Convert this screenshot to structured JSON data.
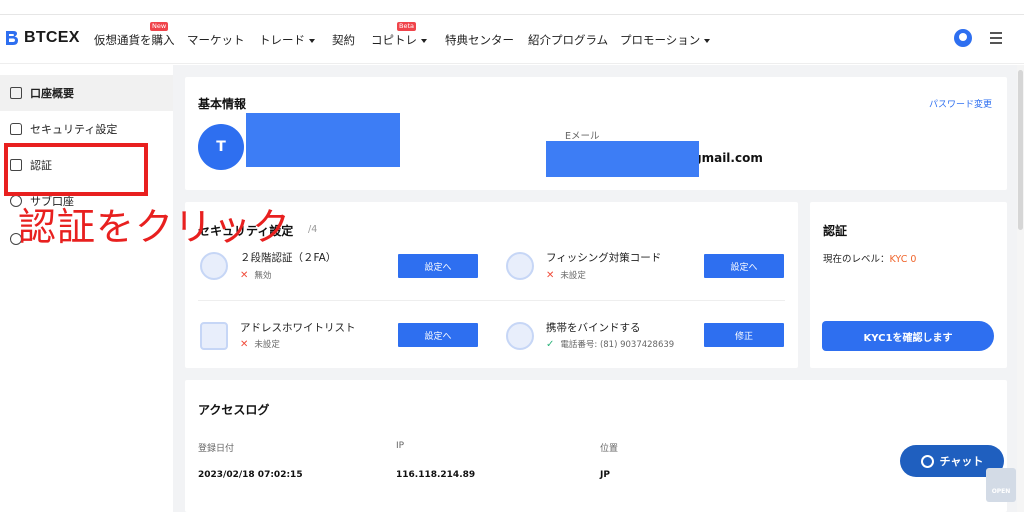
{
  "brand": {
    "name": "BTCEX"
  },
  "nav": {
    "items": [
      {
        "label": "仮想通貨を購入",
        "badge": "New",
        "has_caret": false
      },
      {
        "label": "マーケット",
        "badge": "",
        "has_caret": false
      },
      {
        "label": "トレード",
        "badge": "",
        "has_caret": true
      },
      {
        "label": "契約",
        "badge": "",
        "has_caret": false
      },
      {
        "label": "コピトレ",
        "badge": "Beta",
        "has_caret": true
      },
      {
        "label": "特典センター",
        "badge": "",
        "has_caret": false
      },
      {
        "label": "紹介プログラム",
        "badge": "",
        "has_caret": false
      },
      {
        "label": "プロモーション",
        "badge": "",
        "has_caret": true
      }
    ]
  },
  "sidebar": {
    "items": [
      {
        "label": "口座概要",
        "active": true
      },
      {
        "label": "セキュリティ設定",
        "active": false
      },
      {
        "label": "認証",
        "active": false
      },
      {
        "label": "サブ口座",
        "active": false
      }
    ]
  },
  "annotation": {
    "text": "認証をクリック"
  },
  "basic_info": {
    "title": "基本情報",
    "password_link": "パスワード変更",
    "avatar_initial": "T",
    "email_label": "Eメール",
    "email_suffix": "gmail.com"
  },
  "security": {
    "title": "セキュリティ設定",
    "count": "/4",
    "items": [
      {
        "name": "２段階認証（２FA）",
        "status": "無効",
        "ok": false,
        "button": "設定へ"
      },
      {
        "name": "フィッシング対策コード",
        "status": "未設定",
        "ok": false,
        "button": "設定へ"
      },
      {
        "name": "アドレスホワイトリスト",
        "status": "未設定",
        "ok": false,
        "button": "設定へ"
      },
      {
        "name": "携帯をバインドする",
        "status": "電話番号: (81) 9037428639",
        "ok": true,
        "button": "修正"
      }
    ]
  },
  "kyc": {
    "title": "認証",
    "level_label": "現在のレベル：",
    "level_value": "KYC 0",
    "button": "KYC1を確認します",
    "accent": "#f0652c"
  },
  "access_log": {
    "title": "アクセスログ",
    "columns": [
      "登録日付",
      "IP",
      "位置"
    ],
    "rows": [
      [
        "2023/02/18 07:02:15",
        "116.118.214.89",
        "JP"
      ]
    ]
  },
  "chat": {
    "label": "チャット"
  },
  "open_badge": {
    "label": "OPEN"
  },
  "colors": {
    "primary": "#2e6ff0",
    "annotation_red": "#e8201f"
  }
}
